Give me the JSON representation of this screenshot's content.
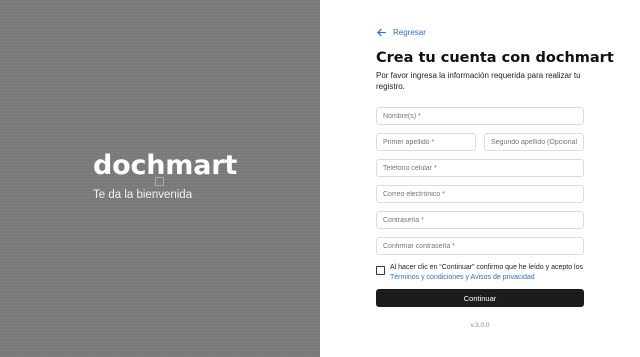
{
  "brand": {
    "name": "dochmart",
    "tagline": "Te da la bienvenida"
  },
  "nav": {
    "back_label": "Regresar"
  },
  "form": {
    "title": "Crea tu cuenta con dochmart",
    "subtitle": "Por favor ingresa la información requerida para realizar tu registro.",
    "fields": {
      "name": "Nombre(s) *",
      "first_surname": "Primer apellido *",
      "second_surname": "Segundo apellido (Opcional)",
      "phone": "Teléfono celular *",
      "email": "Correo electrónico *",
      "password": "Contraseña *",
      "confirm_password": "Confirmar contraseña *"
    },
    "terms": {
      "checked": false,
      "text": "Al hacer clic en “Continuar” confirmo que he leído y acepto los ",
      "link_terms": "Términos y condiciones",
      "conjunction": " y ",
      "link_privacy": "Avisos de privacidad"
    },
    "submit_label": "Continuar"
  },
  "footer": {
    "version": "v.3.0.0"
  },
  "colors": {
    "accent": "#2f6fc9",
    "button": "#1c1c1c",
    "left_panel": "#7b7b7b"
  }
}
